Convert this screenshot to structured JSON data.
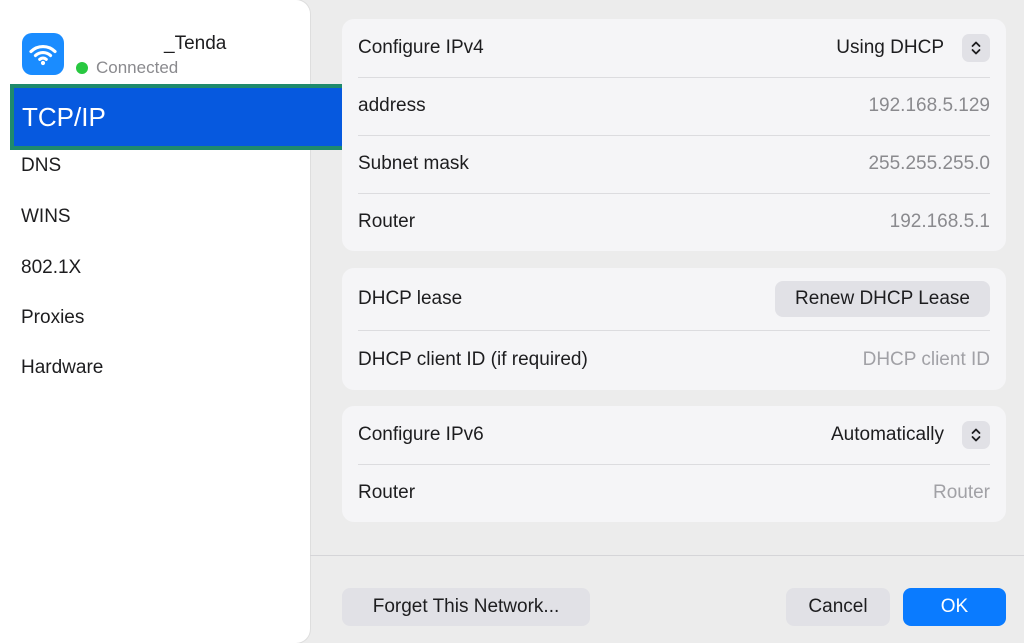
{
  "network": {
    "name": "        _Tenda",
    "status": "Connected",
    "icon": "wifi-icon",
    "status_color": "#28c840",
    "tile_color": "#1a8cff"
  },
  "sidebar": {
    "items": [
      {
        "label": "TCP/IP",
        "selected": true
      },
      {
        "label": "DNS"
      },
      {
        "label": "WINS"
      },
      {
        "label": "802.1X"
      },
      {
        "label": "Proxies"
      },
      {
        "label": "Hardware"
      }
    ]
  },
  "ipv4": {
    "configure_label": "Configure IPv4",
    "configure_value": "Using DHCP",
    "ip_label": " address",
    "ip_value": "192.168.5.129",
    "subnet_label": "Subnet mask",
    "subnet_value": "255.255.255.0",
    "router_label": "Router",
    "router_value": "192.168.5.1"
  },
  "dhcp": {
    "lease_label": "DHCP lease",
    "renew_button": "Renew DHCP Lease",
    "client_id_label": "DHCP client ID (if required)",
    "client_id_placeholder": "DHCP client ID"
  },
  "ipv6": {
    "configure_label": "Configure IPv6",
    "configure_value": "Automatically",
    "router_label": "Router",
    "router_placeholder": "Router"
  },
  "footer": {
    "forget_button": "Forget This Network...",
    "cancel_button": "Cancel",
    "ok_button": "OK"
  },
  "colors": {
    "accent": "#0a7bff",
    "selection": "#0659df",
    "selection_border": "#1e8a6c"
  }
}
